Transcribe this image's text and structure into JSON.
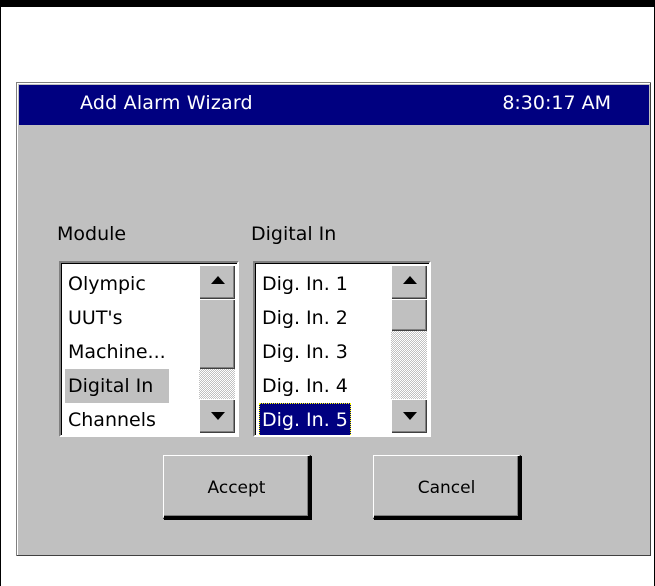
{
  "dialog": {
    "title": "Add Alarm Wizard",
    "time": "8:30:17 AM"
  },
  "module_list": {
    "label": "Module",
    "items": [
      "Olympic",
      "UUT's",
      "Machine...",
      "Digital In",
      "Channels"
    ],
    "selected": "Digital In"
  },
  "digital_in_list": {
    "label": "Digital In",
    "items": [
      "Dig. In. 1",
      "Dig. In. 2",
      "Dig. In. 3",
      "Dig. In. 4",
      "Dig. In. 5"
    ],
    "selected": "Dig. In. 5"
  },
  "buttons": {
    "accept": "Accept",
    "cancel": "Cancel"
  },
  "colors": {
    "title_bar": "#000080",
    "window_face": "#c0c0c0",
    "selection": "#000080"
  },
  "icons": {
    "scroll_up": "triangle-up-icon",
    "scroll_down": "triangle-down-icon"
  }
}
